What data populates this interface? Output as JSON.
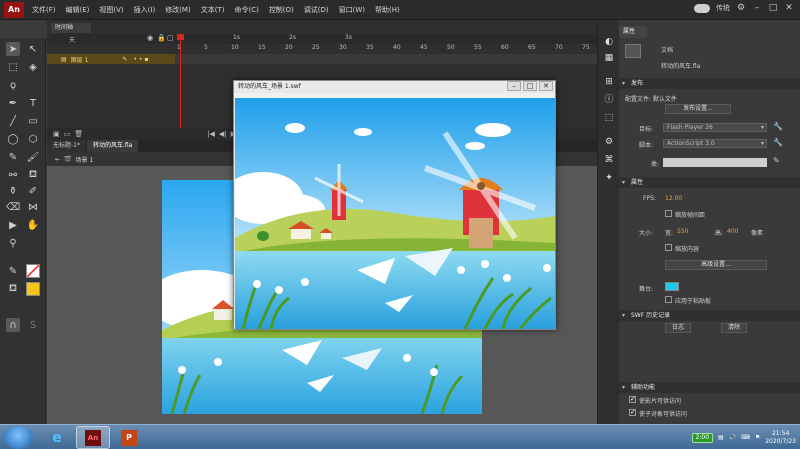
{
  "menubar": {
    "logo": "An",
    "items": [
      "文件(F)",
      "编辑(E)",
      "视图(V)",
      "插入(I)",
      "修改(M)",
      "文本(T)",
      "命令(C)",
      "控制(O)",
      "调试(D)",
      "窗口(W)",
      "帮助(H)"
    ],
    "workspace": "传统"
  },
  "timeline": {
    "tab": "时间轴",
    "layer_name": "图层 1",
    "ruler_numbers": [
      "1",
      "5",
      "10",
      "15",
      "20",
      "25",
      "30",
      "35",
      "40",
      "45",
      "50",
      "55",
      "60",
      "65",
      "70",
      "75"
    ],
    "seconds": [
      "1s",
      "2s",
      "3s"
    ]
  },
  "documents": {
    "tabs": [
      "无标题-1*",
      "转动的风车.fla"
    ],
    "scene": "场景 1"
  },
  "swf_window": {
    "title": "转动的风车_场景 1.swf"
  },
  "properties": {
    "tab": "属性",
    "doc_label": "文档",
    "doc_name": "转动的风车.fla",
    "publish_section": "发布",
    "profile_label": "配置文件: 默认文件",
    "publish_settings": "发布设置...",
    "target_label": "目标:",
    "target_value": "Flash Player 26",
    "script_label": "脚本:",
    "script_value": "ActionScript 3.0",
    "class_label": "类:",
    "props_section": "属性",
    "fps_label": "FPS:",
    "fps_value": "12.00",
    "scale_frames": "缩放帧间距",
    "size_label": "大小:",
    "width_label": "宽:",
    "width_value": "550",
    "height_label": "高:",
    "height_value": "400",
    "size_unit": "像素",
    "scale_content": "缩放内容",
    "advanced_settings": "高级设置...",
    "stage_label": "舞台:",
    "stage_color": "#21c7e8",
    "apply_pasteboard": "应用于粘贴板",
    "swf_history": "SWF 历史记录",
    "log_button": "日志",
    "clear_button": "清除",
    "accessibility": "辅助功能",
    "a11y_movie": "使影片可供访问",
    "a11y_objects": "使子对象可供访问"
  },
  "taskbar": {
    "net_badge": "2:00",
    "time": "21:54",
    "date": "2020/7/23"
  }
}
